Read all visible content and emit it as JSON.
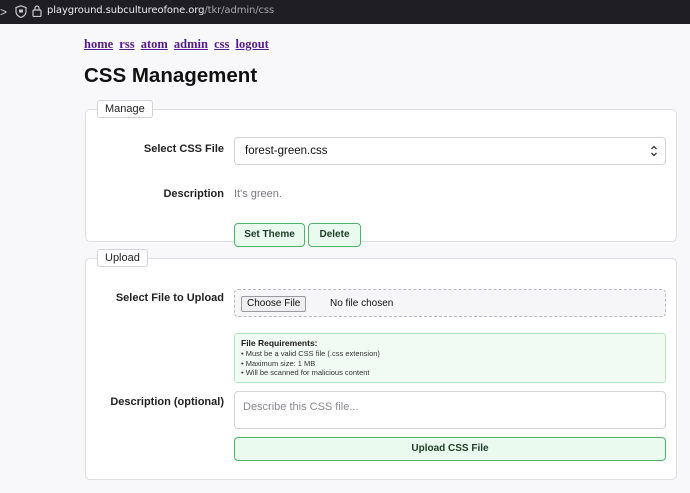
{
  "browser": {
    "back_arrow": ">",
    "url_host": "playground.subcultureofone.org",
    "url_path": "/tkr/admin/css",
    "icons": [
      "shield-icon",
      "lock-icon"
    ]
  },
  "nav": {
    "links": [
      "home",
      "rss",
      "atom",
      "admin",
      "css",
      "logout"
    ]
  },
  "page_title": "CSS Management",
  "manage": {
    "legend": "Manage",
    "select_label": "Select CSS File",
    "selected_file": "forest-green.css",
    "description_label": "Description",
    "description_value": "It's green.",
    "set_theme_button": "Set Theme",
    "delete_button": "Delete"
  },
  "upload": {
    "legend": "Upload",
    "file_label": "Select File to Upload",
    "choose_file_button": "Choose File",
    "no_file_text": "No file chosen",
    "requirements_title": "File Requirements:",
    "requirements": [
      "• Must be a valid CSS file (.css extension)",
      "• Maximum size: 1 MB",
      "• Will be scanned for malicious content"
    ],
    "description_label": "Description (optional)",
    "description_placeholder": "Describe this CSS file...",
    "upload_button": "Upload CSS File"
  },
  "colors": {
    "chrome_bg": "#1f1e24",
    "link": "#551a8b",
    "button_border": "#4cb56a",
    "button_bg": "#eafaee",
    "requirements_bg": "#f0fcf3"
  }
}
